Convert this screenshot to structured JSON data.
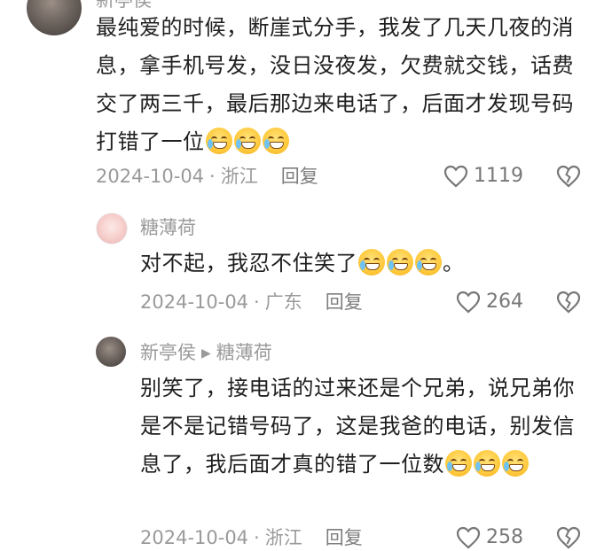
{
  "comments": [
    {
      "author": "新亭侯",
      "text": "最纯爱的时候，断崖式分手，我发了几天几夜的消息，拿手机号发，没日没夜发，欠费就交钱，话费交了两三千，最后那边来电话了，后面才发现号码打错了一位",
      "emoji_count": 3,
      "date": "2024-10-04",
      "location": "浙江",
      "reply_label": "回复",
      "likes": "1119"
    },
    {
      "author": "糖薄荷",
      "text": "对不起，我忍不住笑了",
      "text_suffix": "。",
      "emoji_count": 3,
      "date": "2024-10-04",
      "location": "广东",
      "reply_label": "回复",
      "likes": "264"
    },
    {
      "author": "新亭侯",
      "reply_to": "糖薄荷",
      "text": "别笑了，接电话的过来还是个兄弟，说兄弟你是不是记错号码了，这是我爸的电话，别发信息了，我后面才真的错了一位数",
      "emoji_count": 3,
      "date": "2024-10-04",
      "location": "浙江",
      "reply_label": "回复",
      "likes": "258"
    }
  ],
  "separator": "·",
  "icons": {
    "like": "heart-outline-icon",
    "dislike": "broken-heart-icon",
    "reply_arrow": "triangle-right-icon",
    "emoji": "laughing-tears-emoji"
  }
}
